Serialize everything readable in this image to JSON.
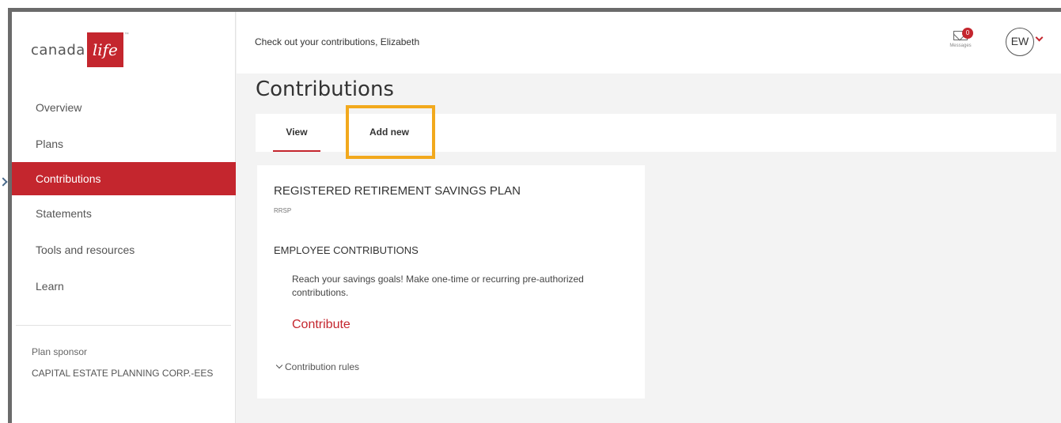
{
  "brand": {
    "word": "canada",
    "box": "life",
    "tm": "™"
  },
  "nav": {
    "items": [
      {
        "label": "Overview"
      },
      {
        "label": "Plans"
      },
      {
        "label": "Contributions"
      },
      {
        "label": "Statements"
      },
      {
        "label": "Tools and resources"
      },
      {
        "label": "Learn"
      }
    ],
    "active": "Contributions"
  },
  "sponsor": {
    "label": "Plan sponsor",
    "name": "CAPITAL ESTATE PLANNING CORP.-EES"
  },
  "header": {
    "greeting": "Check out your contributions, Elizabeth",
    "messages": {
      "count": "0",
      "label": "Messages",
      "icon": "envelope-icon"
    },
    "avatar": {
      "initials": "EW"
    }
  },
  "page": {
    "title": "Contributions"
  },
  "tabs": [
    {
      "label": "View"
    },
    {
      "label": "Add new"
    }
  ],
  "card": {
    "plan_title": "REGISTERED RETIREMENT SAVINGS PLAN",
    "plan_sub": "RRSP",
    "section_title": "EMPLOYEE CONTRIBUTIONS",
    "description": "Reach your savings goals! Make one-time or recurring pre-authorized contributions.",
    "action": "Contribute",
    "rules": "Contribution rules"
  },
  "colors": {
    "brand_red": "#c4262e",
    "highlight": "#f2a91d"
  }
}
